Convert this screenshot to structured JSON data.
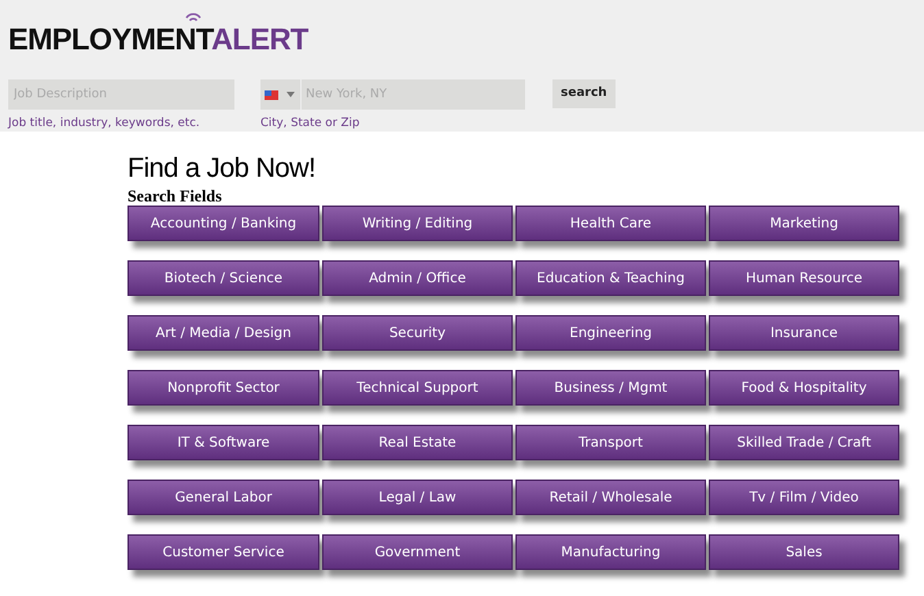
{
  "logo": {
    "part_1": "EMPLOYMENT",
    "part_2": "ALERT"
  },
  "search": {
    "job_field": {
      "placeholder": "Job Description",
      "hint": "Job title, industry, keywords, etc."
    },
    "location_field": {
      "placeholder": "New York, NY",
      "hint": "City, State or Zip"
    },
    "button": "search"
  },
  "heading": "Find a Job Now!",
  "subheading": "Search Fields",
  "fields": [
    "Accounting / Banking",
    "Writing / Editing",
    "Health Care",
    "Marketing",
    "Biotech / Science",
    "Admin / Office",
    "Education & Teaching",
    "Human Resource",
    "Art / Media / Design",
    "Security",
    "Engineering",
    "Insurance",
    "Nonprofit Sector",
    "Technical Support",
    "Business / Mgmt",
    "Food & Hospitality",
    "IT & Software",
    "Real Estate",
    "Transport",
    "Skilled Trade / Craft",
    "General Labor",
    "Legal / Law",
    "Retail / Wholesale",
    "Tv / Film / Video",
    "Customer Service",
    "Government",
    "Manufacturing",
    "Sales"
  ]
}
